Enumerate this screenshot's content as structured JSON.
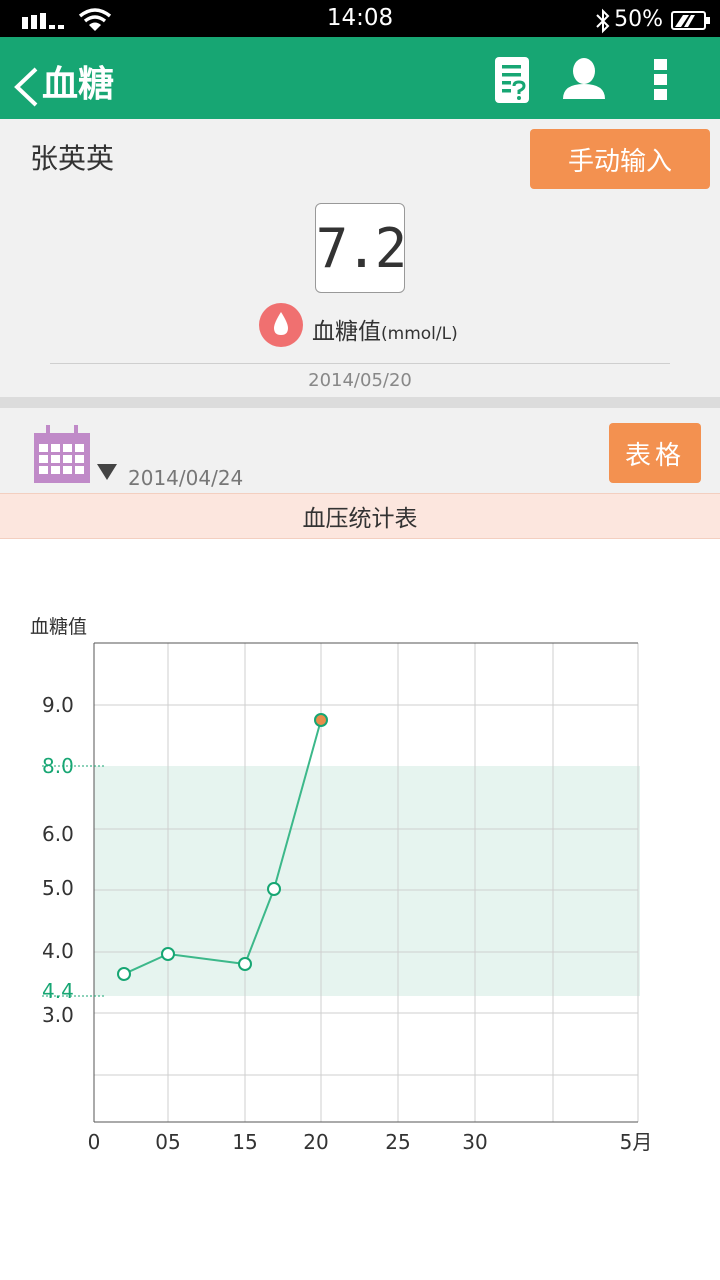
{
  "status_bar": {
    "time": "14:08",
    "battery": "50%"
  },
  "app_bar": {
    "title": "血糖"
  },
  "patient": {
    "name": "张英英"
  },
  "manual_input_label": "手动输入",
  "current": {
    "value": "7.2",
    "label": "血糖值",
    "unit": "(mmol/L)",
    "date": "2014/05/20"
  },
  "filter": {
    "date": "2014/04/24",
    "table_label": "表格"
  },
  "chart_title": "血压统计表",
  "colors": {
    "brand": "#17a673",
    "accent": "#f39150",
    "band": "#e6f4ef",
    "line": "#3cb88a",
    "highlight": "#e88d4a"
  },
  "chart_data": {
    "type": "line",
    "ylabel": "血糖值",
    "y_ticks": [
      "9.0",
      "8.0",
      "6.0",
      "5.0",
      "4.0",
      "4.4",
      "3.0"
    ],
    "x_ticks": [
      "0",
      "05",
      "15",
      "20",
      "25",
      "30",
      "5月"
    ],
    "normal_range": {
      "low": "4.4",
      "high": "8.0"
    },
    "points": [
      {
        "x": 2,
        "y": 3.7
      },
      {
        "x": 5,
        "y": 4.0
      },
      {
        "x": 15,
        "y": 3.8
      },
      {
        "x": 17,
        "y": 5.0
      },
      {
        "x": 20,
        "y": 8.8,
        "highlight": true
      }
    ],
    "grid": true
  }
}
